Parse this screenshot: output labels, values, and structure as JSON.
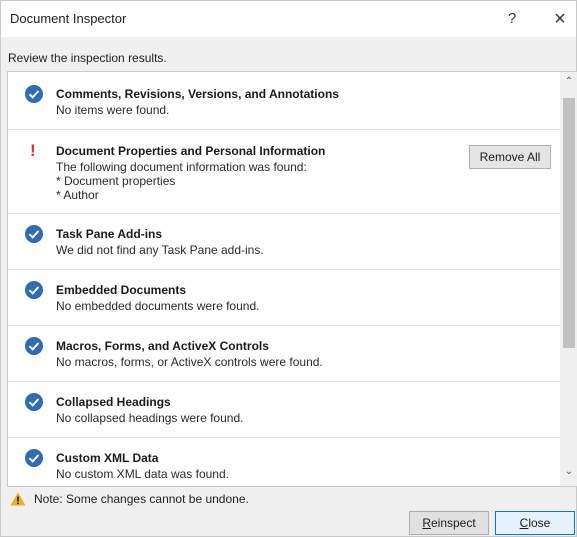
{
  "window": {
    "title": "Document Inspector",
    "help_label": "?",
    "close_glyph": "×"
  },
  "subtitle": "Review the inspection results.",
  "results": [
    {
      "status": "ok",
      "title": "Comments, Revisions, Versions, and Annotations",
      "details": [
        "No items were found."
      ]
    },
    {
      "status": "issue",
      "title": "Document Properties and Personal Information",
      "details": [
        "The following document information was found:",
        "* Document properties",
        "* Author"
      ],
      "action_label": "Remove All"
    },
    {
      "status": "ok",
      "title": "Task Pane Add-ins",
      "details": [
        "We did not find any Task Pane add-ins."
      ]
    },
    {
      "status": "ok",
      "title": "Embedded Documents",
      "details": [
        "No embedded documents were found."
      ]
    },
    {
      "status": "ok",
      "title": "Macros, Forms, and ActiveX Controls",
      "details": [
        "No macros, forms, or ActiveX controls were found."
      ]
    },
    {
      "status": "ok",
      "title": "Collapsed Headings",
      "details": [
        "No collapsed headings were found."
      ]
    },
    {
      "status": "ok",
      "title": "Custom XML Data",
      "details": [
        "No custom XML data was found."
      ]
    }
  ],
  "status_icons": {
    "ok": "checkmark-circle-icon",
    "issue": "exclamation-icon"
  },
  "colors": {
    "ok_icon": "#2f6cb0",
    "issue_icon": "#d9302c",
    "warning_icon": "#e8b21e",
    "default_button_border": "#0078d7"
  },
  "note": "Note: Some changes cannot be undone.",
  "buttons": {
    "reinspect_accel": "R",
    "reinspect_rest": "einspect",
    "close_accel": "C",
    "close_rest": "lose"
  }
}
